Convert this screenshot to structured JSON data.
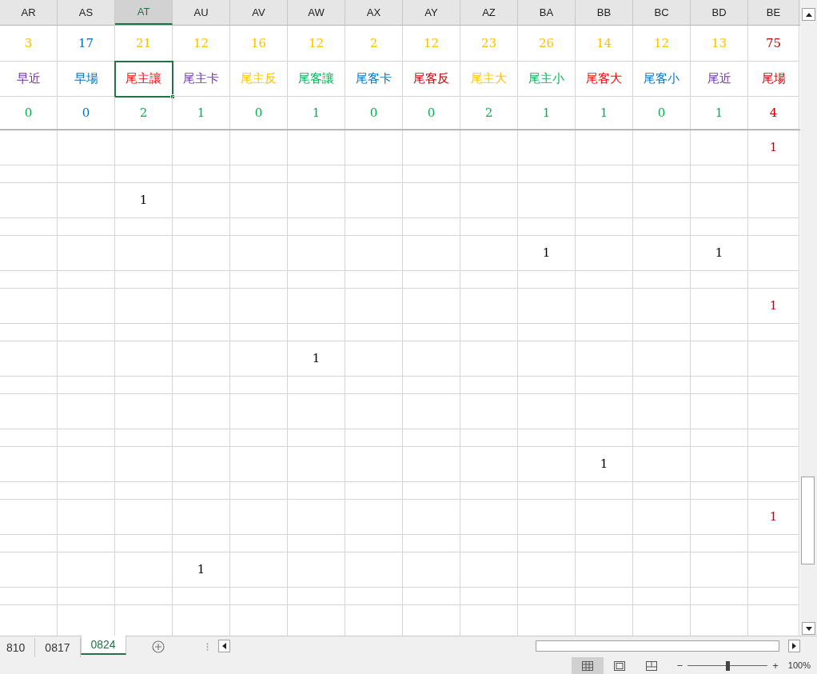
{
  "columns": [
    {
      "letter": "AR",
      "selected": false
    },
    {
      "letter": "AS",
      "selected": false
    },
    {
      "letter": "AT",
      "selected": true
    },
    {
      "letter": "AU",
      "selected": false
    },
    {
      "letter": "AV",
      "selected": false
    },
    {
      "letter": "AW",
      "selected": false
    },
    {
      "letter": "AX",
      "selected": false
    },
    {
      "letter": "AY",
      "selected": false
    },
    {
      "letter": "AZ",
      "selected": false
    },
    {
      "letter": "BA",
      "selected": false
    },
    {
      "letter": "BB",
      "selected": false
    },
    {
      "letter": "BC",
      "selected": false
    },
    {
      "letter": "BD",
      "selected": false
    },
    {
      "letter": "BE",
      "selected": false
    }
  ],
  "totals": [
    {
      "text": "3",
      "color": "#ffc000"
    },
    {
      "text": "17",
      "color": "#0070c0"
    },
    {
      "text": "21",
      "color": "#ffc000"
    },
    {
      "text": "12",
      "color": "#ffc000"
    },
    {
      "text": "16",
      "color": "#ffc000"
    },
    {
      "text": "12",
      "color": "#ffc000"
    },
    {
      "text": "2",
      "color": "#ffc000"
    },
    {
      "text": "12",
      "color": "#ffc000"
    },
    {
      "text": "23",
      "color": "#ffc000"
    },
    {
      "text": "26",
      "color": "#ffc000"
    },
    {
      "text": "14",
      "color": "#ffc000"
    },
    {
      "text": "12",
      "color": "#ffc000"
    },
    {
      "text": "13",
      "color": "#ffc000"
    },
    {
      "text": "75",
      "color": "#c00000"
    }
  ],
  "labels": [
    {
      "text": "早近",
      "color": "#7030a0",
      "selected": false
    },
    {
      "text": "早場",
      "color": "#0070c0",
      "selected": false
    },
    {
      "text": "尾主讓",
      "color": "#ff0000",
      "selected": true
    },
    {
      "text": "尾主卡",
      "color": "#7030a0",
      "selected": false
    },
    {
      "text": "尾主反",
      "color": "#ffc000",
      "selected": false
    },
    {
      "text": "尾客讓",
      "color": "#00b050",
      "selected": false
    },
    {
      "text": "尾客卡",
      "color": "#0070c0",
      "selected": false
    },
    {
      "text": "尾客反",
      "color": "#c00000",
      "selected": false
    },
    {
      "text": "尾主大",
      "color": "#ffc000",
      "selected": false
    },
    {
      "text": "尾主小",
      "color": "#00b050",
      "selected": false
    },
    {
      "text": "尾客大",
      "color": "#ff0000",
      "selected": false
    },
    {
      "text": "尾客小",
      "color": "#0070c0",
      "selected": false
    },
    {
      "text": "尾近",
      "color": "#7030a0",
      "selected": false
    },
    {
      "text": "尾場",
      "color": "#c00000",
      "selected": false
    }
  ],
  "counts": [
    {
      "text": "0",
      "color": "#00b050"
    },
    {
      "text": "0",
      "color": "#0070c0"
    },
    {
      "text": "2",
      "color": "#00b050"
    },
    {
      "text": "1",
      "color": "#00b050"
    },
    {
      "text": "0",
      "color": "#00b050"
    },
    {
      "text": "1",
      "color": "#00b050"
    },
    {
      "text": "0",
      "color": "#00b050"
    },
    {
      "text": "0",
      "color": "#00b050"
    },
    {
      "text": "2",
      "color": "#00b050"
    },
    {
      "text": "1",
      "color": "#00b050"
    },
    {
      "text": "1",
      "color": "#00b050"
    },
    {
      "text": "0",
      "color": "#00b050"
    },
    {
      "text": "1",
      "color": "#00b050"
    },
    {
      "text": "4",
      "color": "#c00000"
    }
  ],
  "body_rows": [
    {
      "kind": "tall",
      "cells": [
        null,
        null,
        null,
        null,
        null,
        null,
        null,
        null,
        null,
        null,
        null,
        null,
        null,
        {
          "text": "1",
          "color": "#c00000"
        }
      ]
    },
    {
      "kind": "short"
    },
    {
      "kind": "tall",
      "cells": [
        null,
        null,
        {
          "text": "1",
          "color": "#000000"
        },
        null,
        null,
        null,
        null,
        null,
        null,
        null,
        null,
        null,
        null,
        null
      ]
    },
    {
      "kind": "short"
    },
    {
      "kind": "tall",
      "cells": [
        null,
        null,
        null,
        null,
        null,
        null,
        null,
        null,
        null,
        {
          "text": "1",
          "color": "#000000"
        },
        null,
        null,
        {
          "text": "1",
          "color": "#000000"
        },
        null
      ]
    },
    {
      "kind": "short"
    },
    {
      "kind": "tall",
      "cells": [
        null,
        null,
        null,
        null,
        null,
        null,
        null,
        null,
        null,
        null,
        null,
        null,
        null,
        {
          "text": "1",
          "color": "#c00000"
        }
      ]
    },
    {
      "kind": "short"
    },
    {
      "kind": "tall",
      "cells": [
        null,
        null,
        null,
        null,
        null,
        {
          "text": "1",
          "color": "#000000"
        },
        null,
        null,
        null,
        null,
        null,
        null,
        null,
        null
      ]
    },
    {
      "kind": "short"
    },
    {
      "kind": "tall",
      "cells": []
    },
    {
      "kind": "short"
    },
    {
      "kind": "tall",
      "cells": [
        null,
        null,
        null,
        null,
        null,
        null,
        null,
        null,
        null,
        null,
        {
          "text": "1",
          "color": "#000000"
        },
        null,
        null,
        null
      ]
    },
    {
      "kind": "short"
    },
    {
      "kind": "tall",
      "cells": [
        null,
        null,
        null,
        null,
        null,
        null,
        null,
        null,
        null,
        null,
        null,
        null,
        null,
        {
          "text": "1",
          "color": "#c00000"
        }
      ]
    },
    {
      "kind": "short"
    },
    {
      "kind": "tall",
      "cells": [
        null,
        null,
        null,
        {
          "text": "1",
          "color": "#000000"
        },
        null,
        null,
        null,
        null,
        null,
        null,
        null,
        null,
        null,
        null
      ]
    },
    {
      "kind": "short"
    },
    {
      "kind": "tall",
      "cells": []
    }
  ],
  "sheet_tabs": [
    {
      "label": "810",
      "selected": false
    },
    {
      "label": "0817",
      "selected": false
    },
    {
      "label": "0824",
      "selected": true
    }
  ],
  "status_bar": {
    "views": [
      {
        "kind": "normal",
        "selected": true
      },
      {
        "kind": "layout",
        "selected": false
      },
      {
        "kind": "breaks",
        "selected": false
      }
    ],
    "zoom": {
      "out_label": "−",
      "in_label": "+",
      "level": 0.5,
      "reading": "100%"
    }
  }
}
